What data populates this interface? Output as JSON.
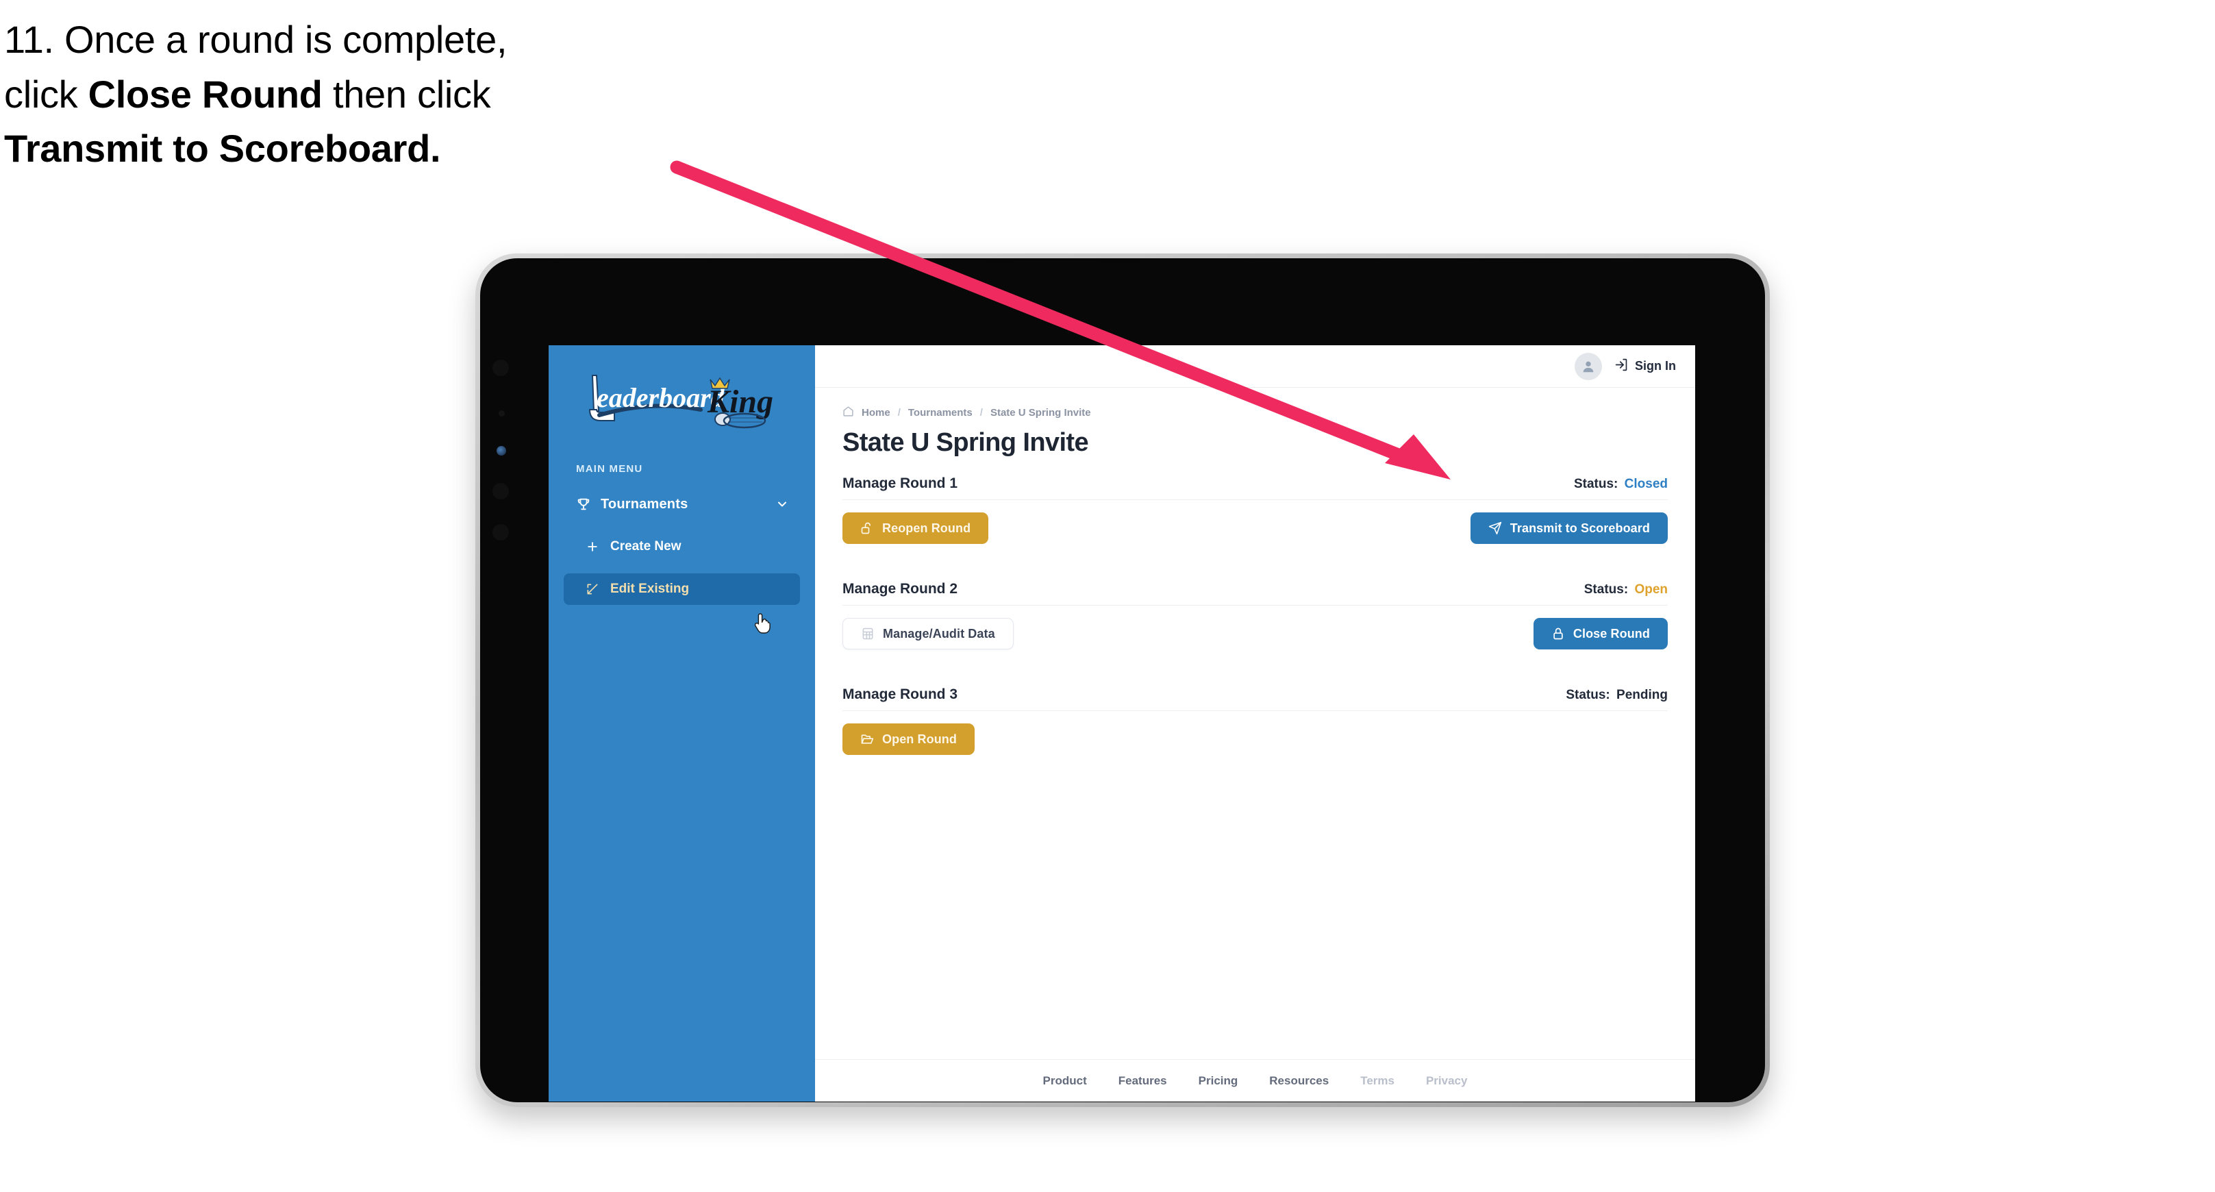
{
  "instruction": {
    "number": "11.",
    "line1_pre": "11. Once a round is complete,",
    "line2_pre": "click ",
    "line2_bold": "Close Round",
    "line2_post": " then click",
    "line3_bold": "Transmit to Scoreboard.",
    "arrow_color": "#ef2a5e"
  },
  "brand": {
    "logo_word1": "Leaderboard",
    "logo_word2": "King",
    "sidebar_color": "#3284c4",
    "active_item_color": "#1f6ba9",
    "active_text_color": "#f3dfae"
  },
  "sidebar": {
    "section_label": "MAIN MENU",
    "items": [
      {
        "label": "Tournaments",
        "icon": "trophy-icon",
        "expanded": true
      },
      {
        "label": "Create New",
        "icon": "plus-icon",
        "active": false
      },
      {
        "label": "Edit Existing",
        "icon": "edit-pencil-icon",
        "active": true
      }
    ]
  },
  "topbar": {
    "avatar_icon": "user-avatar-icon",
    "signin_icon": "sign-in-arrow-icon",
    "signin_label": "Sign In"
  },
  "breadcrumb": {
    "home_icon": "home-icon",
    "items": [
      "Home",
      "Tournaments",
      "State U Spring Invite"
    ],
    "separator": "/"
  },
  "page": {
    "title": "State U Spring Invite"
  },
  "rounds": [
    {
      "title": "Manage Round 1",
      "status_label": "Status:",
      "status_value": "Closed",
      "status_state": "closed",
      "left_button": {
        "label": "Reopen Round",
        "style": "gold",
        "icon": "unlock-icon"
      },
      "right_button": {
        "label": "Transmit to Scoreboard",
        "style": "blue",
        "icon": "paper-plane-icon"
      }
    },
    {
      "title": "Manage Round 2",
      "status_label": "Status:",
      "status_value": "Open",
      "status_state": "open",
      "left_button": {
        "label": "Manage/Audit Data",
        "style": "ghost",
        "icon": "table-grid-icon"
      },
      "right_button": {
        "label": "Close Round",
        "style": "blue",
        "icon": "lock-icon"
      }
    },
    {
      "title": "Manage Round 3",
      "status_label": "Status:",
      "status_value": "Pending",
      "status_state": "pending",
      "left_button": {
        "label": "Open Round",
        "style": "gold",
        "icon": "open-folder-icon"
      },
      "right_button": null
    }
  ],
  "footer": {
    "links": [
      {
        "label": "Product",
        "dim": false
      },
      {
        "label": "Features",
        "dim": false
      },
      {
        "label": "Pricing",
        "dim": false
      },
      {
        "label": "Resources",
        "dim": false
      },
      {
        "label": "Terms",
        "dim": true
      },
      {
        "label": "Privacy",
        "dim": true
      }
    ]
  },
  "colors": {
    "gold": "#d3a02d",
    "blue": "#2a7ab8",
    "status_closed": "#2e7fc4",
    "status_open": "#dfa22c",
    "text_dark": "#232b3a"
  }
}
